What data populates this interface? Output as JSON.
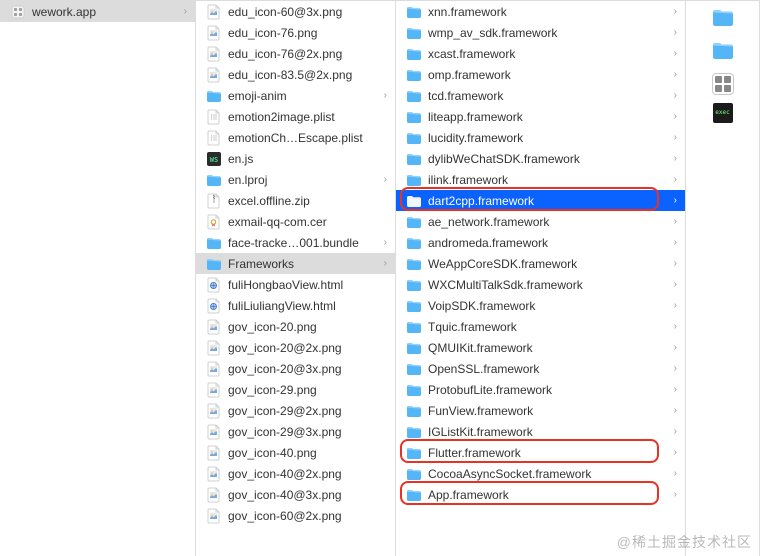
{
  "col1": {
    "items": [
      {
        "name": "wework.app",
        "icon": "app-icon",
        "selectedGray": true,
        "chevron": true
      }
    ]
  },
  "col2": {
    "items": [
      {
        "name": "edu_icon-60@3x.png",
        "icon": "png"
      },
      {
        "name": "edu_icon-76.png",
        "icon": "png"
      },
      {
        "name": "edu_icon-76@2x.png",
        "icon": "png"
      },
      {
        "name": "edu_icon-83.5@2x.png",
        "icon": "png"
      },
      {
        "name": "emoji-anim",
        "icon": "folder",
        "chevron": true
      },
      {
        "name": "emotion2image.plist",
        "icon": "plist"
      },
      {
        "name": "emotionCh…Escape.plist",
        "icon": "plist"
      },
      {
        "name": "en.js",
        "icon": "js"
      },
      {
        "name": "en.lproj",
        "icon": "folder",
        "chevron": true
      },
      {
        "name": "excel.offline.zip",
        "icon": "zip"
      },
      {
        "name": "exmail-qq-com.cer",
        "icon": "cer"
      },
      {
        "name": "face-tracke…001.bundle",
        "icon": "folder",
        "chevron": true
      },
      {
        "name": "Frameworks",
        "icon": "folder",
        "chevron": true,
        "selectedGray": true
      },
      {
        "name": "fuliHongbaoView.html",
        "icon": "html"
      },
      {
        "name": "fuliLiuliangView.html",
        "icon": "html"
      },
      {
        "name": "gov_icon-20.png",
        "icon": "png"
      },
      {
        "name": "gov_icon-20@2x.png",
        "icon": "png"
      },
      {
        "name": "gov_icon-20@3x.png",
        "icon": "png"
      },
      {
        "name": "gov_icon-29.png",
        "icon": "png"
      },
      {
        "name": "gov_icon-29@2x.png",
        "icon": "png"
      },
      {
        "name": "gov_icon-29@3x.png",
        "icon": "png"
      },
      {
        "name": "gov_icon-40.png",
        "icon": "png"
      },
      {
        "name": "gov_icon-40@2x.png",
        "icon": "png"
      },
      {
        "name": "gov_icon-40@3x.png",
        "icon": "png"
      },
      {
        "name": "gov_icon-60@2x.png",
        "icon": "png"
      }
    ]
  },
  "col3": {
    "items": [
      {
        "name": "xnn.framework",
        "chevron": true
      },
      {
        "name": "wmp_av_sdk.framework",
        "chevron": true
      },
      {
        "name": "xcast.framework",
        "chevron": true
      },
      {
        "name": "omp.framework",
        "chevron": true
      },
      {
        "name": "tcd.framework",
        "chevron": true
      },
      {
        "name": "liteapp.framework",
        "chevron": true
      },
      {
        "name": "lucidity.framework",
        "chevron": true
      },
      {
        "name": "dylibWeChatSDK.framework",
        "chevron": true
      },
      {
        "name": "ilink.framework",
        "chevron": true
      },
      {
        "name": "dart2cpp.framework",
        "chevron": true,
        "selectedBlue": true,
        "highlight": true
      },
      {
        "name": "ae_network.framework",
        "chevron": true
      },
      {
        "name": "andromeda.framework",
        "chevron": true
      },
      {
        "name": "WeAppCoreSDK.framework",
        "chevron": true
      },
      {
        "name": "WXCMultiTalkSdk.framework",
        "chevron": true
      },
      {
        "name": "VoipSDK.framework",
        "chevron": true
      },
      {
        "name": "Tquic.framework",
        "chevron": true
      },
      {
        "name": "QMUIKit.framework",
        "chevron": true
      },
      {
        "name": "OpenSSL.framework",
        "chevron": true
      },
      {
        "name": "ProtobufLite.framework",
        "chevron": true
      },
      {
        "name": "FunView.framework",
        "chevron": true
      },
      {
        "name": "IGListKit.framework",
        "chevron": true
      },
      {
        "name": "Flutter.framework",
        "chevron": true,
        "highlight": true
      },
      {
        "name": "CocoaAsyncSocket.framework",
        "chevron": true
      },
      {
        "name": "App.framework",
        "chevron": true,
        "highlight": true
      }
    ]
  },
  "col4": {
    "previews": [
      {
        "kind": "folder-blue"
      },
      {
        "kind": "folder-blue"
      },
      {
        "kind": "grid-light"
      },
      {
        "kind": "exec"
      }
    ]
  },
  "watermark": "@稀土掘金技术社区"
}
